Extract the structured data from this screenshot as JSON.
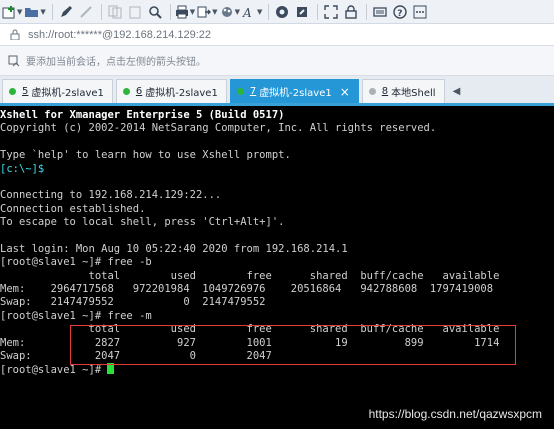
{
  "toolbar": {
    "icons": [
      "new-session-icon",
      "open-folder-icon",
      "edit-pen-icon",
      "disconnect-icon",
      "copy-icon",
      "paste-icon",
      "find-icon",
      "print-icon",
      "transfer-icon",
      "color-scheme-icon",
      "font-icon",
      "xshell-icon",
      "xftp-icon",
      "fullscreen-icon",
      "lock-icon",
      "keyboard-icon",
      "help-icon",
      "more-icon"
    ]
  },
  "address": {
    "url": "ssh://root:******@192.168.214.129:22"
  },
  "hint": {
    "text": "要添加当前会话，点击左侧的箭头按钮。"
  },
  "tabs": [
    {
      "num": "5",
      "label": "虚拟机-2slave1",
      "status": "green",
      "active": false
    },
    {
      "num": "6",
      "label": "虚拟机-2slave1",
      "status": "green",
      "active": false
    },
    {
      "num": "7",
      "label": "虚拟机-2slave1",
      "status": "green",
      "active": true
    },
    {
      "num": "8",
      "label": "本地Shell",
      "status": "gray",
      "active": false
    }
  ],
  "terminal": {
    "lines": [
      "Xshell for Xmanager Enterprise 5 (Build 0517)",
      "Copyright (c) 2002-2014 NetSarang Computer, Inc. All rights reserved.",
      "",
      "Type `help' to learn how to use Xshell prompt.",
      "[c:\\~]$",
      "",
      "Connecting to 192.168.214.129:22...",
      "Connection established.",
      "To escape to local shell, press 'Ctrl+Alt+]'.",
      "",
      "Last login: Mon Aug 10 05:22:40 2020 from 192.168.214.1",
      "[root@slave1 ~]# free -b",
      "              total        used        free      shared  buff/cache   available",
      "Mem:    2964717568   972201984  1049726976    20516864   942788608  1797419008",
      "Swap:   2147479552           0  2147479552",
      "[root@slave1 ~]# free -m",
      "              total        used        free      shared  buff/cache   available",
      "Mem:           2827         927        1001          19         899        1714",
      "Swap:          2047           0        2047",
      "[root@slave1 ~]# "
    ]
  },
  "watermark": "https://blog.csdn.net/qazwsxpcm"
}
